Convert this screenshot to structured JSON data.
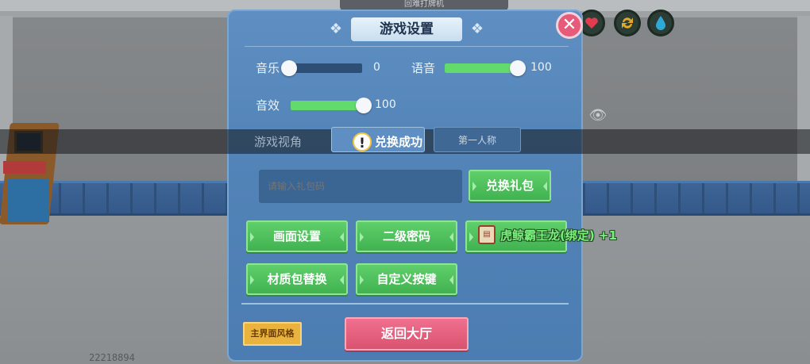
{
  "hud": {
    "top_banner": "回难打牌机",
    "icons": [
      "heart-icon",
      "refresh-icon",
      "water-drop-icon",
      "eye-icon"
    ],
    "version": "22218894"
  },
  "dialog": {
    "title": "游戏设置",
    "close_glyph": "✕",
    "music": {
      "label": "音乐",
      "value": "0",
      "level": 0
    },
    "voice": {
      "label": "语音",
      "value": "100",
      "level": 100
    },
    "sfx": {
      "label": "音效",
      "value": "100",
      "level": 100
    },
    "view": {
      "label": "游戏视角",
      "options": [
        "",
        "第一人称"
      ]
    },
    "gift": {
      "placeholder": "请输入礼包码",
      "redeem_label": "兑换礼包"
    },
    "buttons": {
      "graphics": "画面设置",
      "password": "二级密码",
      "third": "",
      "texture": "材质包替换",
      "keys": "自定义按键"
    },
    "ui_style_label": "主界面风格",
    "back_label": "返回大厅"
  },
  "toast": {
    "text": "兑换成功",
    "icon": "!"
  },
  "reward": {
    "text": "虎鲸霸王龙(绑定) +1",
    "icon": "item-card-icon"
  },
  "colors": {
    "panel": "#5384b8",
    "green_button": "#40b24f",
    "pink_button": "#d9536f",
    "yellow_button": "#e9b33d",
    "slider_fill": "#63db6c"
  }
}
